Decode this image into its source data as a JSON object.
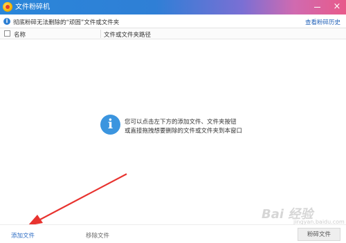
{
  "window": {
    "title": "文件粉碎机",
    "minimize_icon": "minimize-icon",
    "close_glyph": "×"
  },
  "infobar": {
    "icon_glyph": "i",
    "notice": "彻底粉碎无法删除的“顽固”文件或文件夹",
    "history_link": "查看粉碎历史"
  },
  "table": {
    "columns": [
      "名称",
      "文件或文件夹路径"
    ]
  },
  "empty_state": {
    "icon_glyph": "i",
    "line1": "您可以点击左下方的添加文件、文件夹按钮",
    "line2": "或直接拖拽想要删除的文件或文件夹到本窗口"
  },
  "footer": {
    "add_file": "添加文件",
    "remove_file": "移除文件",
    "shred_file": "粉碎文件"
  },
  "watermark": {
    "brand": "Bai 经验",
    "url": "jingyan.baidu.com"
  },
  "colors": {
    "accent": "#2d7fd3",
    "annotation_arrow": "#e8332f",
    "link": "#2262b8"
  }
}
